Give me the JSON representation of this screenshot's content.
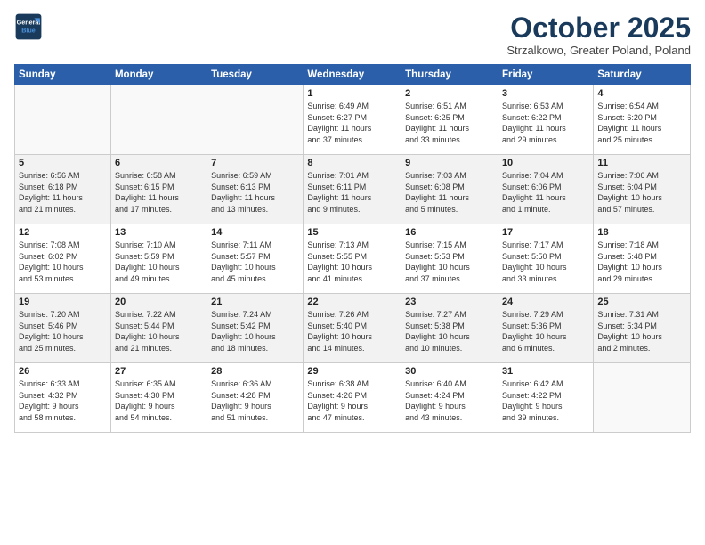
{
  "logo": {
    "line1": "General",
    "line2": "Blue"
  },
  "title": "October 2025",
  "subtitle": "Strzalkowo, Greater Poland, Poland",
  "weekdays": [
    "Sunday",
    "Monday",
    "Tuesday",
    "Wednesday",
    "Thursday",
    "Friday",
    "Saturday"
  ],
  "weeks": [
    [
      {
        "day": "",
        "info": ""
      },
      {
        "day": "",
        "info": ""
      },
      {
        "day": "",
        "info": ""
      },
      {
        "day": "1",
        "info": "Sunrise: 6:49 AM\nSunset: 6:27 PM\nDaylight: 11 hours\nand 37 minutes."
      },
      {
        "day": "2",
        "info": "Sunrise: 6:51 AM\nSunset: 6:25 PM\nDaylight: 11 hours\nand 33 minutes."
      },
      {
        "day": "3",
        "info": "Sunrise: 6:53 AM\nSunset: 6:22 PM\nDaylight: 11 hours\nand 29 minutes."
      },
      {
        "day": "4",
        "info": "Sunrise: 6:54 AM\nSunset: 6:20 PM\nDaylight: 11 hours\nand 25 minutes."
      }
    ],
    [
      {
        "day": "5",
        "info": "Sunrise: 6:56 AM\nSunset: 6:18 PM\nDaylight: 11 hours\nand 21 minutes."
      },
      {
        "day": "6",
        "info": "Sunrise: 6:58 AM\nSunset: 6:15 PM\nDaylight: 11 hours\nand 17 minutes."
      },
      {
        "day": "7",
        "info": "Sunrise: 6:59 AM\nSunset: 6:13 PM\nDaylight: 11 hours\nand 13 minutes."
      },
      {
        "day": "8",
        "info": "Sunrise: 7:01 AM\nSunset: 6:11 PM\nDaylight: 11 hours\nand 9 minutes."
      },
      {
        "day": "9",
        "info": "Sunrise: 7:03 AM\nSunset: 6:08 PM\nDaylight: 11 hours\nand 5 minutes."
      },
      {
        "day": "10",
        "info": "Sunrise: 7:04 AM\nSunset: 6:06 PM\nDaylight: 11 hours\nand 1 minute."
      },
      {
        "day": "11",
        "info": "Sunrise: 7:06 AM\nSunset: 6:04 PM\nDaylight: 10 hours\nand 57 minutes."
      }
    ],
    [
      {
        "day": "12",
        "info": "Sunrise: 7:08 AM\nSunset: 6:02 PM\nDaylight: 10 hours\nand 53 minutes."
      },
      {
        "day": "13",
        "info": "Sunrise: 7:10 AM\nSunset: 5:59 PM\nDaylight: 10 hours\nand 49 minutes."
      },
      {
        "day": "14",
        "info": "Sunrise: 7:11 AM\nSunset: 5:57 PM\nDaylight: 10 hours\nand 45 minutes."
      },
      {
        "day": "15",
        "info": "Sunrise: 7:13 AM\nSunset: 5:55 PM\nDaylight: 10 hours\nand 41 minutes."
      },
      {
        "day": "16",
        "info": "Sunrise: 7:15 AM\nSunset: 5:53 PM\nDaylight: 10 hours\nand 37 minutes."
      },
      {
        "day": "17",
        "info": "Sunrise: 7:17 AM\nSunset: 5:50 PM\nDaylight: 10 hours\nand 33 minutes."
      },
      {
        "day": "18",
        "info": "Sunrise: 7:18 AM\nSunset: 5:48 PM\nDaylight: 10 hours\nand 29 minutes."
      }
    ],
    [
      {
        "day": "19",
        "info": "Sunrise: 7:20 AM\nSunset: 5:46 PM\nDaylight: 10 hours\nand 25 minutes."
      },
      {
        "day": "20",
        "info": "Sunrise: 7:22 AM\nSunset: 5:44 PM\nDaylight: 10 hours\nand 21 minutes."
      },
      {
        "day": "21",
        "info": "Sunrise: 7:24 AM\nSunset: 5:42 PM\nDaylight: 10 hours\nand 18 minutes."
      },
      {
        "day": "22",
        "info": "Sunrise: 7:26 AM\nSunset: 5:40 PM\nDaylight: 10 hours\nand 14 minutes."
      },
      {
        "day": "23",
        "info": "Sunrise: 7:27 AM\nSunset: 5:38 PM\nDaylight: 10 hours\nand 10 minutes."
      },
      {
        "day": "24",
        "info": "Sunrise: 7:29 AM\nSunset: 5:36 PM\nDaylight: 10 hours\nand 6 minutes."
      },
      {
        "day": "25",
        "info": "Sunrise: 7:31 AM\nSunset: 5:34 PM\nDaylight: 10 hours\nand 2 minutes."
      }
    ],
    [
      {
        "day": "26",
        "info": "Sunrise: 6:33 AM\nSunset: 4:32 PM\nDaylight: 9 hours\nand 58 minutes."
      },
      {
        "day": "27",
        "info": "Sunrise: 6:35 AM\nSunset: 4:30 PM\nDaylight: 9 hours\nand 54 minutes."
      },
      {
        "day": "28",
        "info": "Sunrise: 6:36 AM\nSunset: 4:28 PM\nDaylight: 9 hours\nand 51 minutes."
      },
      {
        "day": "29",
        "info": "Sunrise: 6:38 AM\nSunset: 4:26 PM\nDaylight: 9 hours\nand 47 minutes."
      },
      {
        "day": "30",
        "info": "Sunrise: 6:40 AM\nSunset: 4:24 PM\nDaylight: 9 hours\nand 43 minutes."
      },
      {
        "day": "31",
        "info": "Sunrise: 6:42 AM\nSunset: 4:22 PM\nDaylight: 9 hours\nand 39 minutes."
      },
      {
        "day": "",
        "info": ""
      }
    ]
  ]
}
